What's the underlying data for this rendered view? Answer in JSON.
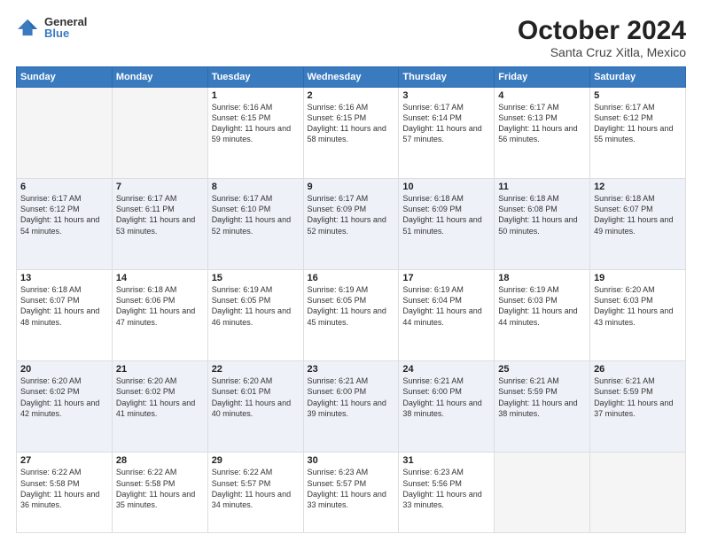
{
  "logo": {
    "general": "General",
    "blue": "Blue"
  },
  "title": "October 2024",
  "subtitle": "Santa Cruz Xitla, Mexico",
  "weekdays": [
    "Sunday",
    "Monday",
    "Tuesday",
    "Wednesday",
    "Thursday",
    "Friday",
    "Saturday"
  ],
  "weeks": [
    [
      {
        "day": "",
        "info": ""
      },
      {
        "day": "",
        "info": ""
      },
      {
        "day": "1",
        "info": "Sunrise: 6:16 AM\nSunset: 6:15 PM\nDaylight: 11 hours and 59 minutes."
      },
      {
        "day": "2",
        "info": "Sunrise: 6:16 AM\nSunset: 6:15 PM\nDaylight: 11 hours and 58 minutes."
      },
      {
        "day": "3",
        "info": "Sunrise: 6:17 AM\nSunset: 6:14 PM\nDaylight: 11 hours and 57 minutes."
      },
      {
        "day": "4",
        "info": "Sunrise: 6:17 AM\nSunset: 6:13 PM\nDaylight: 11 hours and 56 minutes."
      },
      {
        "day": "5",
        "info": "Sunrise: 6:17 AM\nSunset: 6:12 PM\nDaylight: 11 hours and 55 minutes."
      }
    ],
    [
      {
        "day": "6",
        "info": "Sunrise: 6:17 AM\nSunset: 6:12 PM\nDaylight: 11 hours and 54 minutes."
      },
      {
        "day": "7",
        "info": "Sunrise: 6:17 AM\nSunset: 6:11 PM\nDaylight: 11 hours and 53 minutes."
      },
      {
        "day": "8",
        "info": "Sunrise: 6:17 AM\nSunset: 6:10 PM\nDaylight: 11 hours and 52 minutes."
      },
      {
        "day": "9",
        "info": "Sunrise: 6:17 AM\nSunset: 6:09 PM\nDaylight: 11 hours and 52 minutes."
      },
      {
        "day": "10",
        "info": "Sunrise: 6:18 AM\nSunset: 6:09 PM\nDaylight: 11 hours and 51 minutes."
      },
      {
        "day": "11",
        "info": "Sunrise: 6:18 AM\nSunset: 6:08 PM\nDaylight: 11 hours and 50 minutes."
      },
      {
        "day": "12",
        "info": "Sunrise: 6:18 AM\nSunset: 6:07 PM\nDaylight: 11 hours and 49 minutes."
      }
    ],
    [
      {
        "day": "13",
        "info": "Sunrise: 6:18 AM\nSunset: 6:07 PM\nDaylight: 11 hours and 48 minutes."
      },
      {
        "day": "14",
        "info": "Sunrise: 6:18 AM\nSunset: 6:06 PM\nDaylight: 11 hours and 47 minutes."
      },
      {
        "day": "15",
        "info": "Sunrise: 6:19 AM\nSunset: 6:05 PM\nDaylight: 11 hours and 46 minutes."
      },
      {
        "day": "16",
        "info": "Sunrise: 6:19 AM\nSunset: 6:05 PM\nDaylight: 11 hours and 45 minutes."
      },
      {
        "day": "17",
        "info": "Sunrise: 6:19 AM\nSunset: 6:04 PM\nDaylight: 11 hours and 44 minutes."
      },
      {
        "day": "18",
        "info": "Sunrise: 6:19 AM\nSunset: 6:03 PM\nDaylight: 11 hours and 44 minutes."
      },
      {
        "day": "19",
        "info": "Sunrise: 6:20 AM\nSunset: 6:03 PM\nDaylight: 11 hours and 43 minutes."
      }
    ],
    [
      {
        "day": "20",
        "info": "Sunrise: 6:20 AM\nSunset: 6:02 PM\nDaylight: 11 hours and 42 minutes."
      },
      {
        "day": "21",
        "info": "Sunrise: 6:20 AM\nSunset: 6:02 PM\nDaylight: 11 hours and 41 minutes."
      },
      {
        "day": "22",
        "info": "Sunrise: 6:20 AM\nSunset: 6:01 PM\nDaylight: 11 hours and 40 minutes."
      },
      {
        "day": "23",
        "info": "Sunrise: 6:21 AM\nSunset: 6:00 PM\nDaylight: 11 hours and 39 minutes."
      },
      {
        "day": "24",
        "info": "Sunrise: 6:21 AM\nSunset: 6:00 PM\nDaylight: 11 hours and 38 minutes."
      },
      {
        "day": "25",
        "info": "Sunrise: 6:21 AM\nSunset: 5:59 PM\nDaylight: 11 hours and 38 minutes."
      },
      {
        "day": "26",
        "info": "Sunrise: 6:21 AM\nSunset: 5:59 PM\nDaylight: 11 hours and 37 minutes."
      }
    ],
    [
      {
        "day": "27",
        "info": "Sunrise: 6:22 AM\nSunset: 5:58 PM\nDaylight: 11 hours and 36 minutes."
      },
      {
        "day": "28",
        "info": "Sunrise: 6:22 AM\nSunset: 5:58 PM\nDaylight: 11 hours and 35 minutes."
      },
      {
        "day": "29",
        "info": "Sunrise: 6:22 AM\nSunset: 5:57 PM\nDaylight: 11 hours and 34 minutes."
      },
      {
        "day": "30",
        "info": "Sunrise: 6:23 AM\nSunset: 5:57 PM\nDaylight: 11 hours and 33 minutes."
      },
      {
        "day": "31",
        "info": "Sunrise: 6:23 AM\nSunset: 5:56 PM\nDaylight: 11 hours and 33 minutes."
      },
      {
        "day": "",
        "info": ""
      },
      {
        "day": "",
        "info": ""
      }
    ]
  ]
}
